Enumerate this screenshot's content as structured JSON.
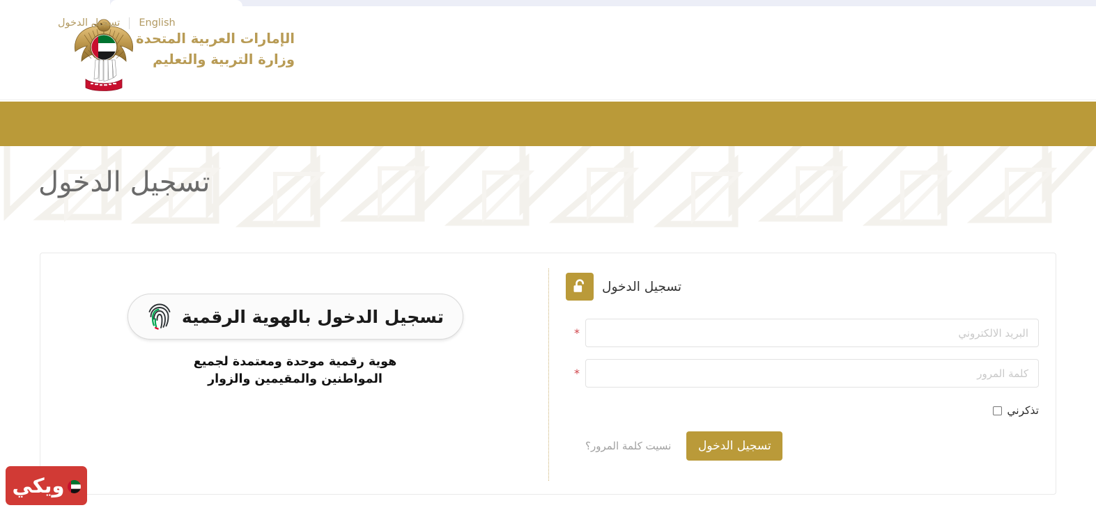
{
  "header": {
    "brand_line1": "الإمارات العربية المتحدة",
    "brand_line2": "وزارة التربية والتعليم",
    "emblem_icon": "uae-falcon-emblem-icon"
  },
  "top_nav": {
    "login_link": "تسجيل الدخول",
    "language_link": "English"
  },
  "hero": {
    "page_title": "تسجيل الدخول"
  },
  "login_form": {
    "heading": "تسجيل الدخول",
    "lock_icon": "unlock-icon",
    "email": {
      "placeholder": "البريد الالكتروني",
      "value": "",
      "required_marker": "*"
    },
    "password": {
      "placeholder": "كلمة المرور",
      "value": "",
      "required_marker": "*"
    },
    "remember_label": "تذكرني",
    "remember_checked": false,
    "submit_label": "تسجيل الدخول",
    "forgot_label": "نسيت كلمة المرور؟"
  },
  "uae_pass": {
    "button_label": "تسجيل الدخول بالهوية الرقمية",
    "fingerprint_icon": "uaepass-fingerprint-icon",
    "subtitle_line1": "هوية رقمية موحدة ومعتمدة لجميع",
    "subtitle_line2": "المواطنين والمقيمين والزوار"
  },
  "watermark": {
    "label": "ويكي",
    "flag_icon": "uae-flag-icon"
  },
  "colors": {
    "gold": "#ba9a39",
    "brand_text_gold": "#b89b55",
    "nav_gold": "#b29a62",
    "title_grey": "#6a6a6a",
    "required_red": "#d0444a",
    "watermark_red": "#d13a35",
    "uaepass_green": "#00a651"
  }
}
